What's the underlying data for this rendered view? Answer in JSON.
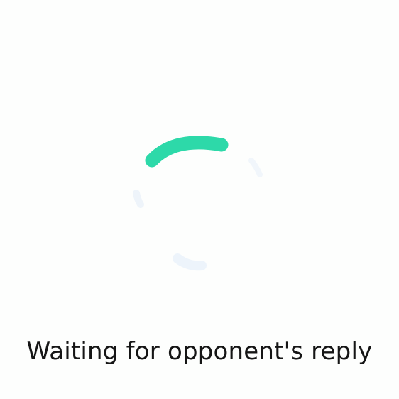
{
  "status": {
    "message": "Waiting for opponent's reply"
  },
  "loading_indicator": {
    "icon": "spinner-icon",
    "accent_color": "#2dd9a9",
    "faint_color": "#eef5fb"
  }
}
